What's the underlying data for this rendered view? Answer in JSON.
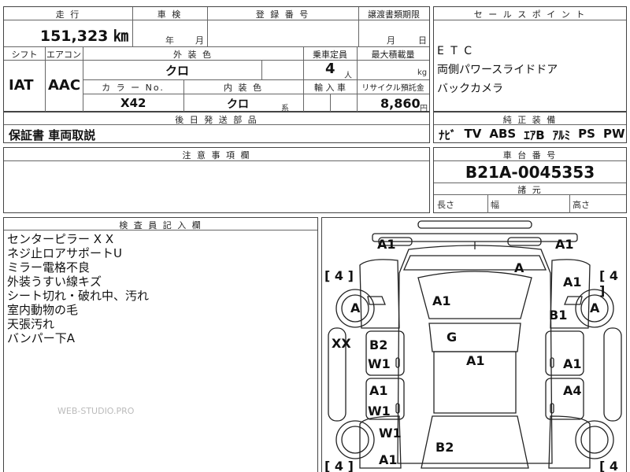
{
  "top": {
    "mileage_label": "走 行",
    "mileage_value": "151,323 ㎞",
    "inspection_label": "車 検",
    "inspection_year": "年",
    "inspection_month": "月",
    "reg_label": "登 録 番 号",
    "transfer_label": "譲渡書類期限",
    "transfer_month": "月",
    "transfer_day": "日",
    "shift_label": "シフト",
    "shift_value": "IAT",
    "ac_label": "エアコン",
    "ac_value": "AAC",
    "ext_color_label": "外 装 色",
    "ext_color_value": "クロ",
    "capacity_label": "乗車定員",
    "capacity_value": "4",
    "capacity_unit": "人",
    "maxload_label": "最大積載量",
    "maxload_unit": "kg",
    "colorno_label": "カ ラ ー No.",
    "colorno_value": "X42",
    "int_color_label": "内 装 色",
    "int_color_value": "クロ",
    "int_color_suffix": "系",
    "import_label": "輸 入 車",
    "recycle_label": "リサイクル預託金",
    "recycle_value": "8,860",
    "recycle_unit": "円",
    "later_label": "後 日 発 送 部 品",
    "later_value": "保証書 車両取説"
  },
  "sales": {
    "label": "セ ー ル ス ポ イ ン ト",
    "points": [
      "E T C",
      "両側パワースライドドア",
      "バックカメラ"
    ],
    "equip_label": "純 正 装 備",
    "equip": [
      "ﾅﾋﾞ",
      "TV",
      "ABS",
      "ｴｱB",
      "ｱﾙﾐ",
      "PS",
      "PW"
    ]
  },
  "notice": {
    "label": "注 意 事 項 欄"
  },
  "chassis": {
    "label": "車 台 番 号",
    "value": "B21A-0045353",
    "dims_label": "諸 元",
    "length": "長さ",
    "width": "幅",
    "height": "高さ"
  },
  "inspector": {
    "label": "検 査 員 記 入 欄",
    "notes": [
      "センターピラー X X",
      "ネジ止ロアサポートU",
      "ミラー電格不良",
      "外装うすい線キズ",
      "シート切れ・破れ中、汚れ",
      "室内動物の毛",
      "天張汚れ",
      "バンパー下A"
    ],
    "watermark": "WEB-STUDIO.PRO"
  },
  "diagram": {
    "marks": {
      "front_left": "A1",
      "front_right": "A1",
      "windshield": "A",
      "hood": "A1",
      "right_front_fender": "A1",
      "right_mirror": "B1",
      "left_wheel_front": "A",
      "right_wheel_front": "A",
      "left_pillar": "XX",
      "roof": "G",
      "roof2": "A1",
      "left_front_door_top": "B2",
      "left_front_door_bot": "W1",
      "right_front_door": "A1",
      "left_rear_door_top": "A1",
      "left_rear_door_bot": "W1",
      "right_rear_door": "A4",
      "left_rear_quarter": "W1",
      "trunk": "B2",
      "rear_left": "A1"
    },
    "brackets": {
      "tl": "[ 4 ]",
      "tr": "[ 4 ]",
      "bl": "[ 4 ]",
      "br": "[ 4 ]"
    }
  }
}
